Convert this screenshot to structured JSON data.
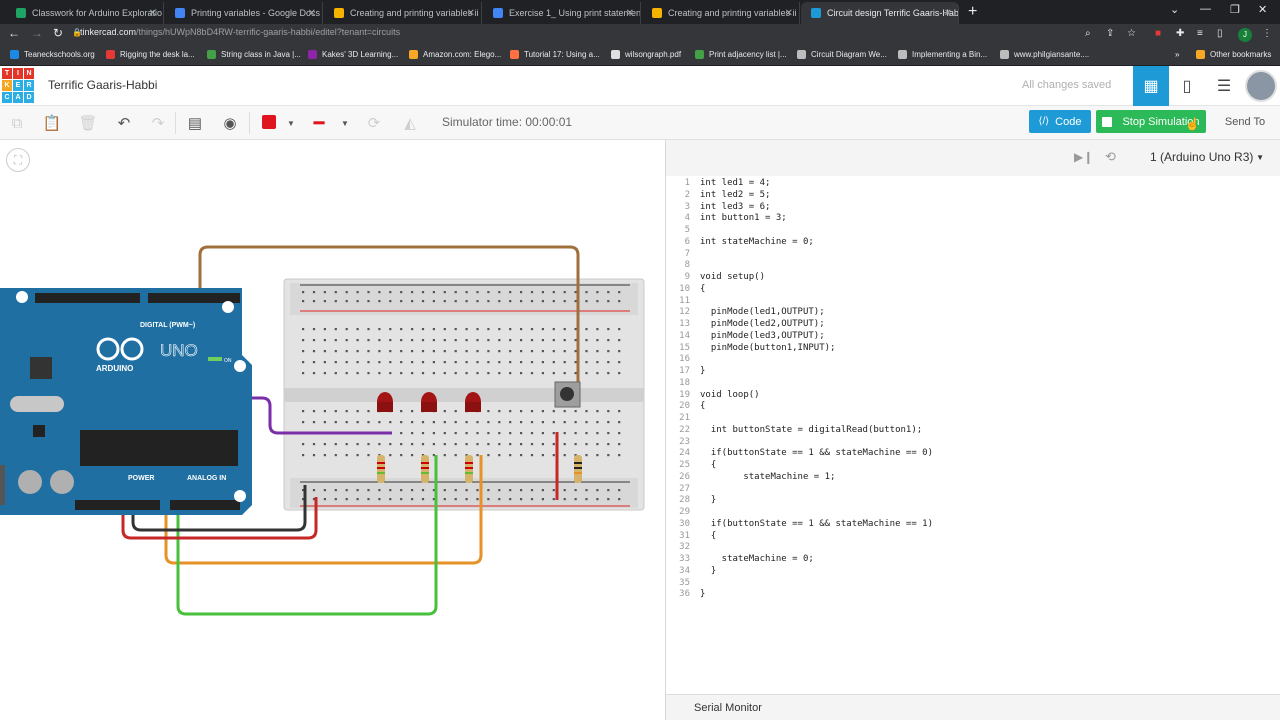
{
  "browser": {
    "tabs": [
      {
        "title": "Classwork for Arduino Exploratio",
        "fav": "#1fa463"
      },
      {
        "title": "Printing variables - Google Docs",
        "fav": "#4285f4"
      },
      {
        "title": "Creating and printing variables ii",
        "fav": "#f4b400"
      },
      {
        "title": "Exercise 1_ Using print statement",
        "fav": "#4285f4"
      },
      {
        "title": "Creating and printing variables ii",
        "fav": "#f4b400"
      },
      {
        "title": "Circuit design Terrific Gaaris-Habb",
        "fav": "#1e9bd7"
      }
    ],
    "url_main": "tinkercad.com",
    "url_rest": "/things/hUWpN8bD4RW-terrific-gaaris-habbi/editel?tenant=circuits",
    "profile_initial": "J",
    "bookmarks": [
      "Teaneckschools.org",
      "Rigging the desk la...",
      "String class in Java |...",
      "Kakes' 3D Learning...",
      "Amazon.com: Elego...",
      "Tutorial 17: Using a...",
      "wilsongraph.pdf",
      "Print adjacency list |...",
      "Circuit Diagram We...",
      "Implementing a Bin...",
      "www.philgiansante....",
      "Other bookmarks"
    ]
  },
  "app": {
    "logo_letters": [
      "T",
      "I",
      "N",
      "K",
      "E",
      "R",
      "C",
      "A",
      "D"
    ],
    "design_title": "Terrific Gaaris-Habbi",
    "save_status": "All changes saved",
    "simulator_time": "Simulator time: 00:00:01",
    "code_label": "Code",
    "stop_label": "Stop Simulation",
    "send_label": "Send To",
    "board_select": "1 (Arduino Uno R3)",
    "serial_monitor": "Serial Monitor",
    "brand_color": "#1e9bd7",
    "stop_color": "#2cb957"
  },
  "code": [
    "int led1 = 4;",
    "int led2 = 5;",
    "int led3 = 6;",
    "int button1 = 3;",
    "",
    "int stateMachine = 0;",
    "",
    "",
    "void setup()",
    "{",
    "",
    "  pinMode(led1,OUTPUT);",
    "  pinMode(led2,OUTPUT);",
    "  pinMode(led3,OUTPUT);",
    "  pinMode(button1,INPUT);",
    "",
    "}",
    "",
    "void loop()",
    "{",
    "",
    "  int buttonState = digitalRead(button1);",
    "",
    "  if(buttonState == 1 && stateMachine == 0)",
    "  {",
    "        stateMachine = 1;",
    "",
    "  }",
    "",
    "  if(buttonState == 1 && stateMachine == 1)",
    "  {",
    "",
    "    stateMachine = 0;",
    "  }",
    "",
    "}"
  ],
  "circuit": {
    "arduino_label": "ARDUINO",
    "uno_label": "UNO",
    "digital_label": "DIGITAL (PWM~)",
    "power_label": "POWER",
    "analog_label": "ANALOG IN",
    "on_label": "ON"
  }
}
